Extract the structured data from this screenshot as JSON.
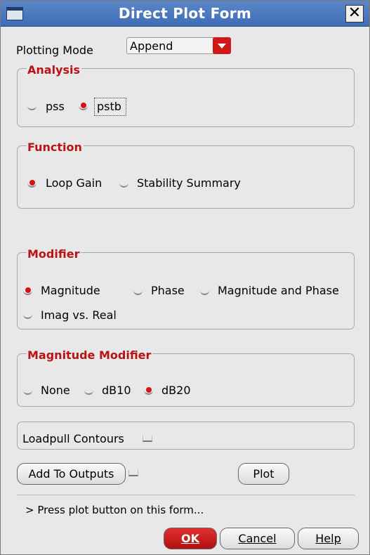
{
  "window": {
    "title": "Direct Plot Form",
    "close_glyph": "✕"
  },
  "plotting_mode": {
    "label": "Plotting Mode",
    "value": "Append"
  },
  "analysis": {
    "title": "Analysis",
    "options": [
      {
        "label": "pss",
        "selected": false
      },
      {
        "label": "pstb",
        "selected": true
      }
    ]
  },
  "function": {
    "title": "Function",
    "options": [
      {
        "label": "Loop Gain",
        "selected": true
      },
      {
        "label": "Stability Summary",
        "selected": false
      }
    ]
  },
  "modifier": {
    "title": "Modifier",
    "options": [
      {
        "label": "Magnitude",
        "selected": true
      },
      {
        "label": "Phase",
        "selected": false
      },
      {
        "label": "Magnitude and Phase",
        "selected": false
      },
      {
        "label": "Imag vs. Real",
        "selected": false
      }
    ]
  },
  "magnitude_modifier": {
    "title": "Magnitude Modifier",
    "options": [
      {
        "label": "None",
        "selected": false
      },
      {
        "label": "dB10",
        "selected": false
      },
      {
        "label": "dB20",
        "selected": true
      }
    ]
  },
  "loadpull": {
    "label": "Loadpull Contours",
    "checked": false
  },
  "actions": {
    "add_to_outputs": "Add To Outputs",
    "add_checked": false,
    "plot": "Plot"
  },
  "status": "> Press plot button on this form...",
  "footer": {
    "ok": "OK",
    "cancel": "Cancel",
    "help": "Help"
  },
  "colors": {
    "accent_red": "#b81414",
    "titlebar_blue": "#4a78bf"
  }
}
